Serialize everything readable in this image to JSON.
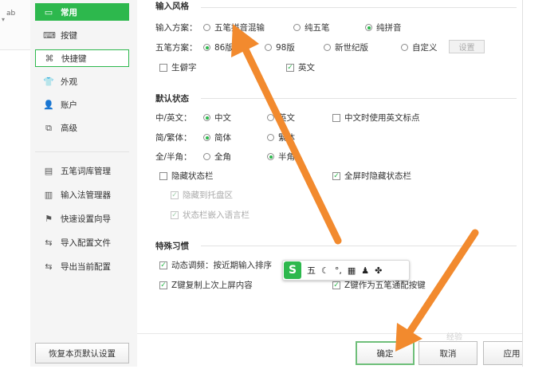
{
  "left_strip": {
    "text": "ab",
    "caret": "▾"
  },
  "sidebar": {
    "items": [
      {
        "label": "常用",
        "icon": "monitor-icon",
        "glyph": "▭"
      },
      {
        "label": "按键",
        "icon": "keyboard-icon",
        "glyph": "⌨"
      },
      {
        "label": "快捷键",
        "icon": "shortcut-key-icon",
        "glyph": "⌘"
      },
      {
        "label": "外观",
        "icon": "shirt-icon",
        "glyph": "👕"
      },
      {
        "label": "账户",
        "icon": "user-icon",
        "glyph": "👤"
      },
      {
        "label": "高级",
        "icon": "layers-icon",
        "glyph": "⧉"
      },
      {
        "label": "五笔词库管理",
        "icon": "dictionary-icon",
        "glyph": "▤"
      },
      {
        "label": "输入法管理器",
        "icon": "manager-icon",
        "glyph": "▥"
      },
      {
        "label": "快速设置向导",
        "icon": "flag-icon",
        "glyph": "⚑"
      },
      {
        "label": "导入配置文件",
        "icon": "import-icon",
        "glyph": "⇆"
      },
      {
        "label": "导出当前配置",
        "icon": "export-icon",
        "glyph": "⇆"
      }
    ],
    "reset_label": "恢复本页默认设置"
  },
  "input_style": {
    "title": "输入风格",
    "scheme_label": "输入方案：",
    "scheme_options": [
      "五笔拼音混输",
      "纯五笔",
      "纯拼音"
    ],
    "scheme_selected": "纯拼音",
    "wubi_label": "五笔方案：",
    "wubi_options": [
      "86版",
      "98版",
      "新世纪版",
      "自定义"
    ],
    "wubi_selected": "86版",
    "settings_button": "设置",
    "rare_chars": "生僻字",
    "english": "英文"
  },
  "default_state": {
    "title": "默认状态",
    "lang_label": "中/英文：",
    "lang_options": [
      "中文",
      "英文"
    ],
    "lang_selected": "中文",
    "chinese_english_punct": "中文时使用英文标点",
    "script_label": "简/繁体：",
    "script_options": [
      "简体",
      "繁体"
    ],
    "script_selected": "简体",
    "width_label": "全/半角：",
    "width_options": [
      "全角",
      "半角"
    ],
    "width_selected": "半角",
    "hide_status_bar": "隐藏状态栏",
    "hide_on_fullscreen": "全屏时隐藏状态栏",
    "hide_to_tray": "隐藏到托盘区",
    "embed_language_bar": "状态栏嵌入语言栏"
  },
  "special_habits": {
    "title": "特殊习惯",
    "dynamic_adjust": "动态调频：按近期输入排序",
    "z_key_copy": "Z键复制上次上屏内容",
    "z_key_wildcard": "Z键作为五笔通配按键"
  },
  "status_toolbar": {
    "logo": "S",
    "items": [
      "五",
      "☾",
      "°,",
      "▦",
      "♟",
      "✤"
    ]
  },
  "footer": {
    "ok": "确定",
    "cancel": "取消",
    "apply": "应用"
  },
  "watermark": "经验",
  "colors": {
    "accent": "#2db84d",
    "arrow": "#f28a2e"
  }
}
